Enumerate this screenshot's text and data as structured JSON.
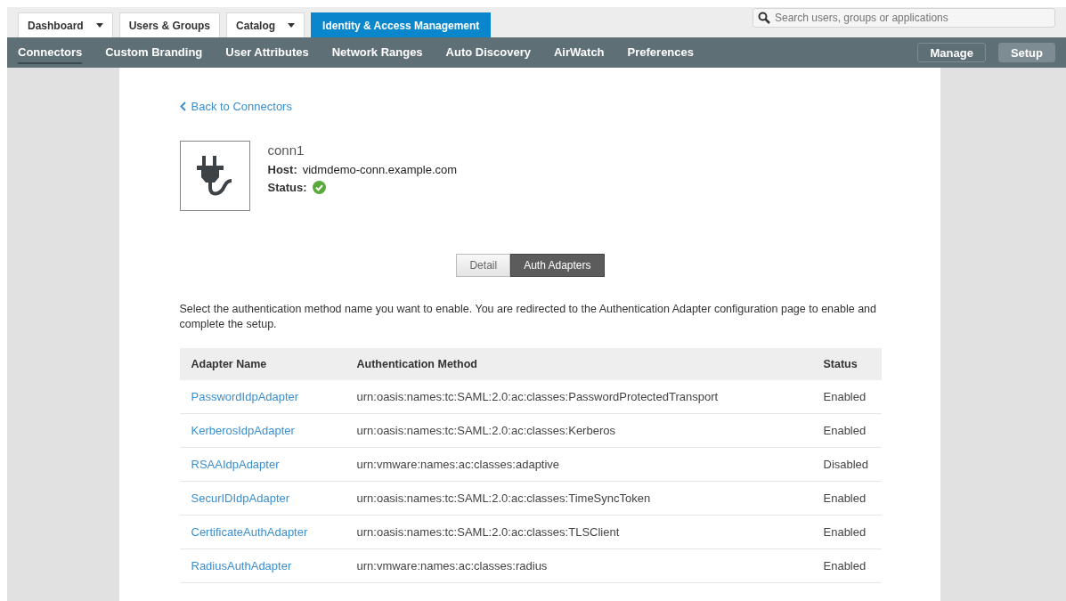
{
  "top_tabs": [
    {
      "label": "Dashboard",
      "has_menu": true,
      "selected": false
    },
    {
      "label": "Users & Groups",
      "has_menu": false,
      "selected": false
    },
    {
      "label": "Catalog",
      "has_menu": true,
      "selected": false
    },
    {
      "label": "Identity & Access Management",
      "has_menu": false,
      "selected": true
    }
  ],
  "search": {
    "placeholder": "Search users, groups or applications"
  },
  "nav": [
    {
      "label": "Connectors",
      "selected": true
    },
    {
      "label": "Custom Branding",
      "selected": false
    },
    {
      "label": "User Attributes",
      "selected": false
    },
    {
      "label": "Network Ranges",
      "selected": false
    },
    {
      "label": "Auto Discovery",
      "selected": false
    },
    {
      "label": "AirWatch",
      "selected": false
    },
    {
      "label": "Preferences",
      "selected": false
    }
  ],
  "modes": [
    {
      "label": "Manage",
      "selected": false
    },
    {
      "label": "Setup",
      "selected": true
    }
  ],
  "back_link": "Back to Connectors",
  "connector": {
    "name": "conn1",
    "host_label": "Host:",
    "host": "vidmdemo-conn.example.com",
    "status_label": "Status:",
    "status_ok": true
  },
  "view_tabs": [
    {
      "label": "Detail",
      "selected": false
    },
    {
      "label": "Auth Adapters",
      "selected": true
    }
  ],
  "intro": "Select the authentication method name you want to enable. You are redirected to the Authentication Adapter configuration page to enable and complete the setup.",
  "table": {
    "columns": [
      "Adapter Name",
      "Authentication Method",
      "Status"
    ],
    "rows": [
      {
        "name": "PasswordIdpAdapter",
        "method": "urn:oasis:names:tc:SAML:2.0:ac:classes:PasswordProtectedTransport",
        "status": "Enabled"
      },
      {
        "name": "KerberosIdpAdapter",
        "method": "urn:oasis:names:tc:SAML:2.0:ac:classes:Kerberos",
        "status": "Enabled"
      },
      {
        "name": "RSAAIdpAdapter",
        "method": "urn:vmware:names:ac:classes:adaptive",
        "status": "Disabled"
      },
      {
        "name": "SecurIDIdpAdapter",
        "method": "urn:oasis:names:tc:SAML:2.0:ac:classes:TimeSyncToken",
        "status": "Enabled"
      },
      {
        "name": "CertificateAuthAdapter",
        "method": "urn:oasis:names:tc:SAML:2.0:ac:classes:TLSClient",
        "status": "Enabled"
      },
      {
        "name": "RadiusAuthAdapter",
        "method": "urn:vmware:names:ac:classes:radius",
        "status": "Enabled"
      }
    ]
  }
}
